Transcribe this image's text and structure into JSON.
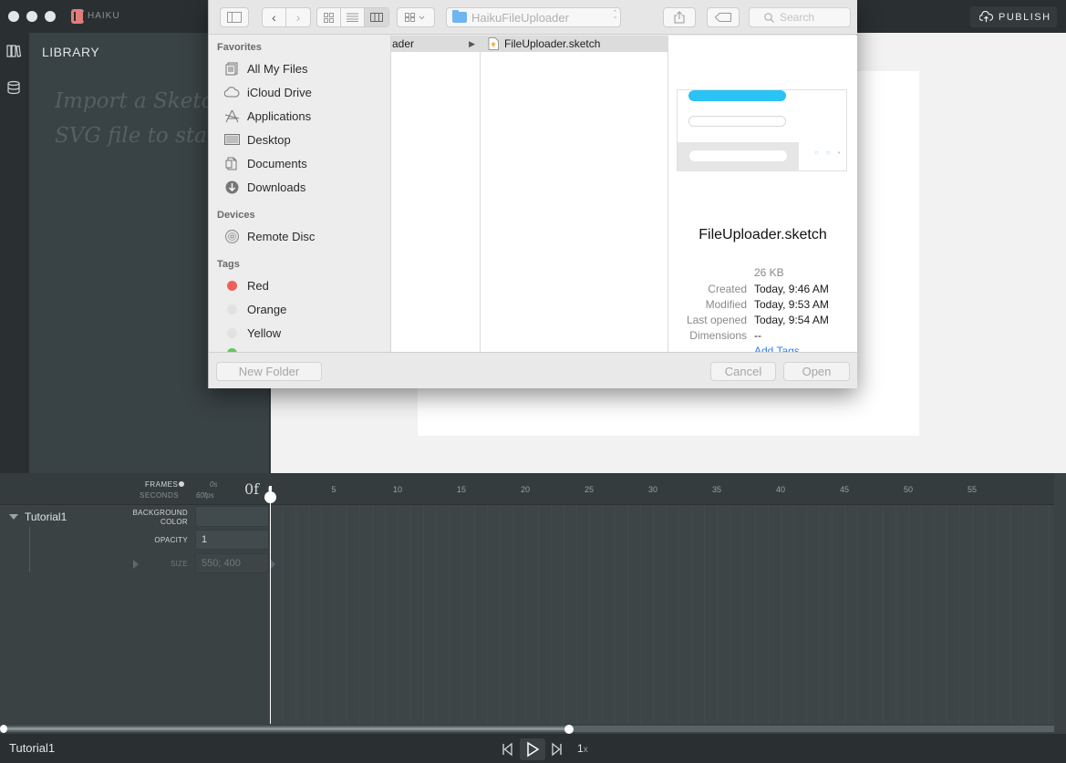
{
  "app": {
    "name": "HAIKU",
    "publish_label": "PUBLISH"
  },
  "library": {
    "title": "LIBRARY",
    "hint": "Import a Sketch or SVG file to start"
  },
  "dialog": {
    "path_folder": "HaikuFileUploader",
    "search_placeholder": "Search",
    "sidebar": {
      "favorites_header": "Favorites",
      "favorites": [
        {
          "label": "All My Files",
          "icon": "all-files-icon"
        },
        {
          "label": "iCloud Drive",
          "icon": "cloud-icon"
        },
        {
          "label": "Applications",
          "icon": "applications-icon"
        },
        {
          "label": "Desktop",
          "icon": "desktop-icon"
        },
        {
          "label": "Documents",
          "icon": "documents-icon"
        },
        {
          "label": "Downloads",
          "icon": "downloads-icon"
        }
      ],
      "devices_header": "Devices",
      "devices": [
        {
          "label": "Remote Disc",
          "icon": "disc-icon"
        }
      ],
      "tags_header": "Tags",
      "tags": [
        {
          "label": "Red",
          "color": "#f0605a"
        },
        {
          "label": "Orange",
          "color": "#e2e2e2"
        },
        {
          "label": "Yellow",
          "color": "#e2e2e2"
        }
      ]
    },
    "columns": {
      "parent_folder": "ader",
      "file": "FileUploader.sketch"
    },
    "preview": {
      "file_name": "FileUploader.sketch",
      "size": "26 KB",
      "meta": [
        {
          "key": "Created",
          "value": "Today, 9:46 AM"
        },
        {
          "key": "Modified",
          "value": "Today, 9:53 AM"
        },
        {
          "key": "Last opened",
          "value": "Today, 9:54 AM"
        },
        {
          "key": "Dimensions",
          "value": "--"
        }
      ],
      "add_tags": "Add Tags..."
    },
    "footer": {
      "new_folder": "New Folder",
      "cancel": "Cancel",
      "open": "Open"
    }
  },
  "timeline": {
    "frames_label": "FRAMES",
    "seconds_label": "SECONDS",
    "time": "0s",
    "fps": "60fps",
    "current_frame": "0f",
    "ticks": [
      "0",
      "5",
      "10",
      "15",
      "20",
      "25",
      "30",
      "35",
      "40",
      "45",
      "50",
      "55"
    ],
    "component": "Tutorial1",
    "props": {
      "background_color_label": "BACKGROUND COLOR",
      "opacity_label": "OPACITY",
      "opacity_value": "1",
      "size_label": "SIZE",
      "size_value": "550; 400"
    },
    "bottom_title": "Tutorial1",
    "speed": "1",
    "speed_suffix": "x"
  },
  "colors": {
    "accent_cyan": "#29c3f5",
    "tag_red": "#f0605a",
    "link_blue": "#2f7ef5"
  }
}
